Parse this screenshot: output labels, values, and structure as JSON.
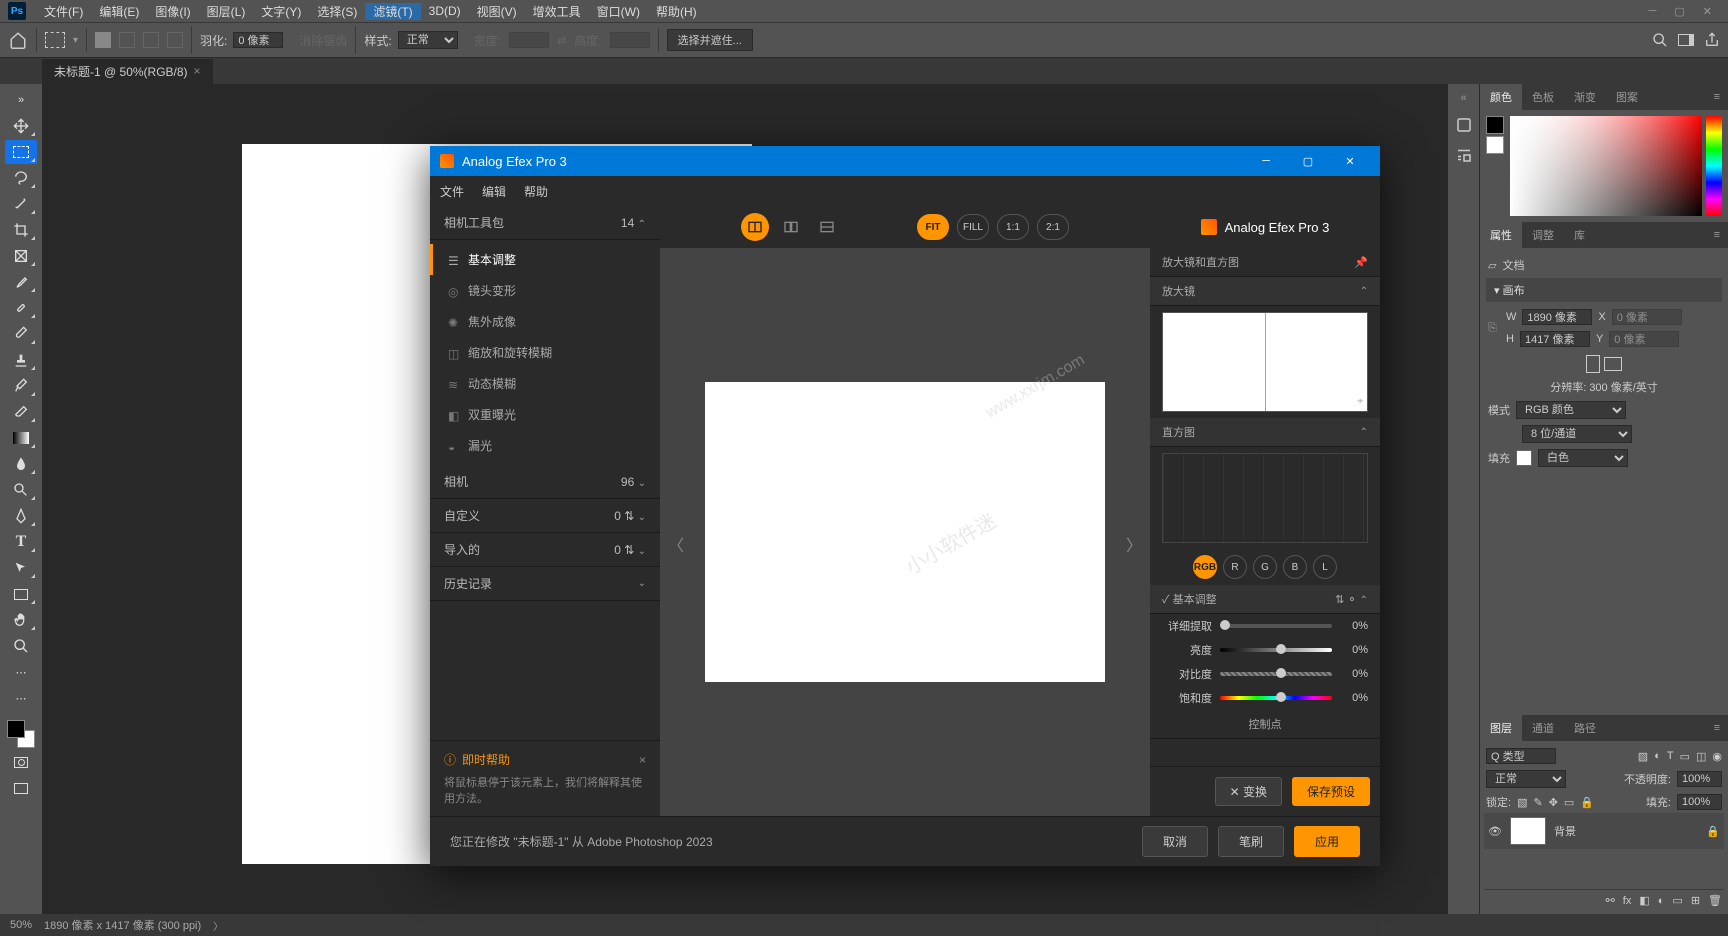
{
  "app": {
    "logo": "Ps"
  },
  "menu": [
    "文件(F)",
    "编辑(E)",
    "图像(I)",
    "图层(L)",
    "文字(Y)",
    "选择(S)",
    "滤镜(T)",
    "3D(D)",
    "视图(V)",
    "增效工具",
    "窗口(W)",
    "帮助(H)"
  ],
  "menu_active_index": 6,
  "optbar": {
    "feather_label": "羽化:",
    "feather_val": "0 像素",
    "antialias": "消除锯齿",
    "style_label": "样式:",
    "style_val": "正常",
    "width_label": "宽度:",
    "height_label": "高度:",
    "mask_btn": "选择并遮住..."
  },
  "doc_tab": "未标题-1 @ 50%(RGB/8)",
  "panels": {
    "color_tabs": [
      "颜色",
      "色板",
      "渐变",
      "图案"
    ],
    "props_tabs": [
      "属性",
      "调整",
      "库"
    ],
    "doc_label": "文档",
    "canvas_section": "画布",
    "w_label": "W",
    "w_val": "1890 像素",
    "x_label": "X",
    "x_val": "0 像素",
    "h_label": "H",
    "h_val": "1417 像素",
    "y_label": "Y",
    "y_val": "0 像素",
    "resolution": "分辨率: 300 像素/英寸",
    "mode_label": "模式",
    "mode_val": "RGB 颜色",
    "bits_val": "8 位/通道",
    "fill_label": "填充",
    "fill_val": "白色",
    "layers_tabs": [
      "图层",
      "通道",
      "路径"
    ],
    "layer_type": "Q 类型",
    "blend": "正常",
    "opacity_label": "不透明度:",
    "opacity_val": "100%",
    "lock_label": "锁定:",
    "fill_opacity_label": "填充:",
    "fill_opacity_val": "100%",
    "bg_layer": "背景"
  },
  "status": {
    "zoom": "50%",
    "doc_info": "1890 像素 x 1417 像素 (300 ppi)"
  },
  "plugin": {
    "title": "Analog Efex Pro 3",
    "menu": [
      "文件",
      "编辑",
      "帮助"
    ],
    "brand": "Analog Efex Pro 3",
    "left": {
      "kit_section": "相机工具包",
      "kit_count": "14",
      "items": [
        "基本调整",
        "镜头变形",
        "焦外成像",
        "缩放和旋转模糊",
        "动态模糊",
        "双重曝光",
        "漏光"
      ],
      "camera_section": "相机",
      "camera_count": "96",
      "custom_section": "自定义",
      "custom_count": "0",
      "import_section": "导入的",
      "import_count": "0",
      "history_section": "历史记录",
      "help_title": "即时帮助",
      "help_text": "将鼠标悬停于该元素上，我们将解释其使用方法。"
    },
    "zoom": {
      "fit": "FIT",
      "fill": "FILL",
      "one": "1:1",
      "two": "2:1"
    },
    "right": {
      "magnifier_full": "放大镜和直方图",
      "magnifier": "放大镜",
      "histogram": "直方图",
      "channels": [
        "RGB",
        "R",
        "G",
        "B",
        "L"
      ],
      "basic_section": "基本调整",
      "detail": "详细提取",
      "brightness": "亮度",
      "contrast": "对比度",
      "saturation": "饱和度",
      "zero": "0%",
      "ctrl_points": "控制点",
      "shuffle_btn": "变换",
      "save_preset_btn": "保存预设"
    },
    "footer": {
      "msg": "您正在修改 \"未标题-1\" 从 Adobe Photoshop 2023",
      "cancel": "取消",
      "brush": "笔刷",
      "apply": "应用"
    }
  }
}
